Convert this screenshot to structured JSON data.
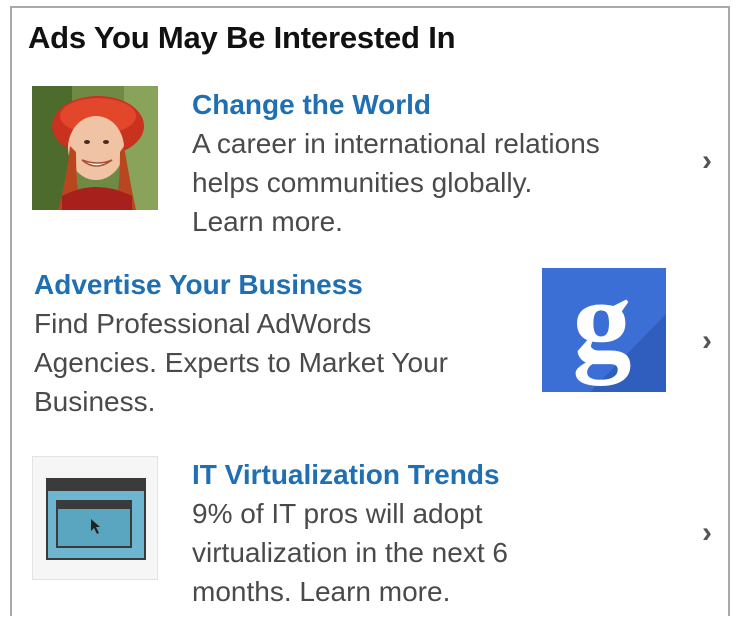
{
  "header": {
    "title": "Ads You May Be Interested In"
  },
  "ads": [
    {
      "title": "Change the World",
      "description": "A career in international relations\nhelps communities globally.\nLearn more.",
      "chevron": "›",
      "image": "woman-portrait-image"
    },
    {
      "title": "Advertise Your Business",
      "description": "Find Professional AdWords\nAgencies. Experts to Market Your\nBusiness.",
      "chevron": "›",
      "image": "google-logo-icon",
      "image_text": "g",
      "image_color": "#3b6fd6"
    },
    {
      "title": "IT Virtualization Trends",
      "description": "9% of IT pros will adopt\nvirtualization in the next 6\nmonths. Learn more.",
      "chevron": "›",
      "image": "window-screen-icon",
      "image_color": "#6eb6cf"
    }
  ]
}
